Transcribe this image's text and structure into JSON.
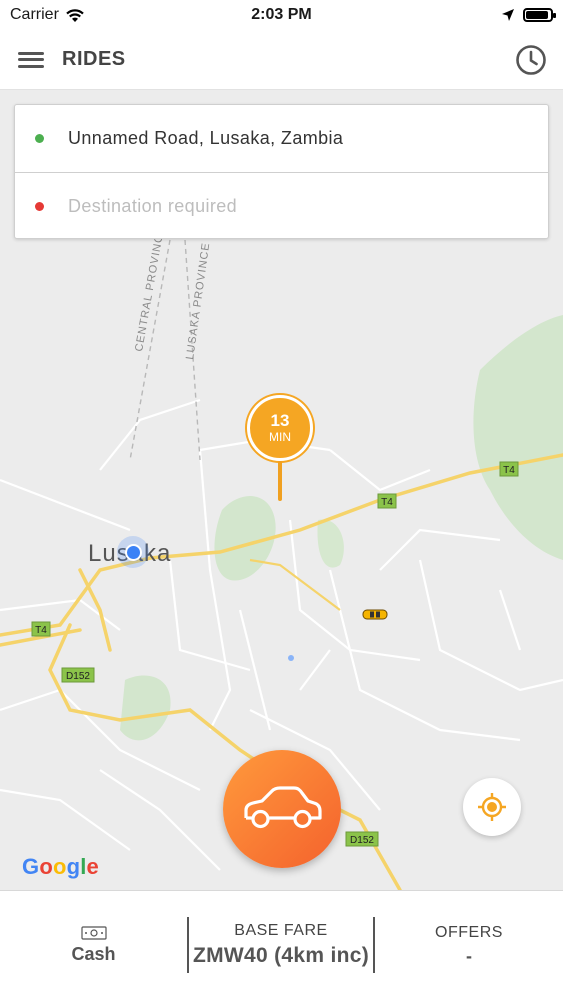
{
  "status_bar": {
    "carrier": "Carrier",
    "time": "2:03 PM",
    "battery_level": 0.9
  },
  "header": {
    "title": "RIDES",
    "menu_icon": "hamburger-menu-icon",
    "history_icon": "clock-icon"
  },
  "address": {
    "pickup": {
      "text": "Unnamed Road, Lusaka, Zambia",
      "dot_color": "#4caf50"
    },
    "destination": {
      "placeholder": "Destination required",
      "dot_color": "#e53935"
    }
  },
  "map": {
    "city_label": "Lusaka",
    "road_labels": {
      "central_province": "CENTRAL PROVINCE",
      "lusaka_province": "LUSAKA PROVINCE",
      "t4": "T4",
      "d152": "D152"
    },
    "eta": {
      "value": "13",
      "unit": "MIN",
      "color": "#f5a623"
    },
    "google_logo": "Google"
  },
  "actions": {
    "request_ride_icon": "car-icon",
    "request_ride_color": "#f47a2f",
    "my_location_icon": "crosshair-location-icon",
    "my_location_color": "#f5a623"
  },
  "bottom_bar": {
    "payment": {
      "icon": "cash-icon",
      "label": "Cash"
    },
    "base_fare": {
      "label": "BASE FARE",
      "value": "ZMW40 (4km inc)"
    },
    "offers": {
      "label": "OFFERS",
      "value": "-"
    }
  }
}
